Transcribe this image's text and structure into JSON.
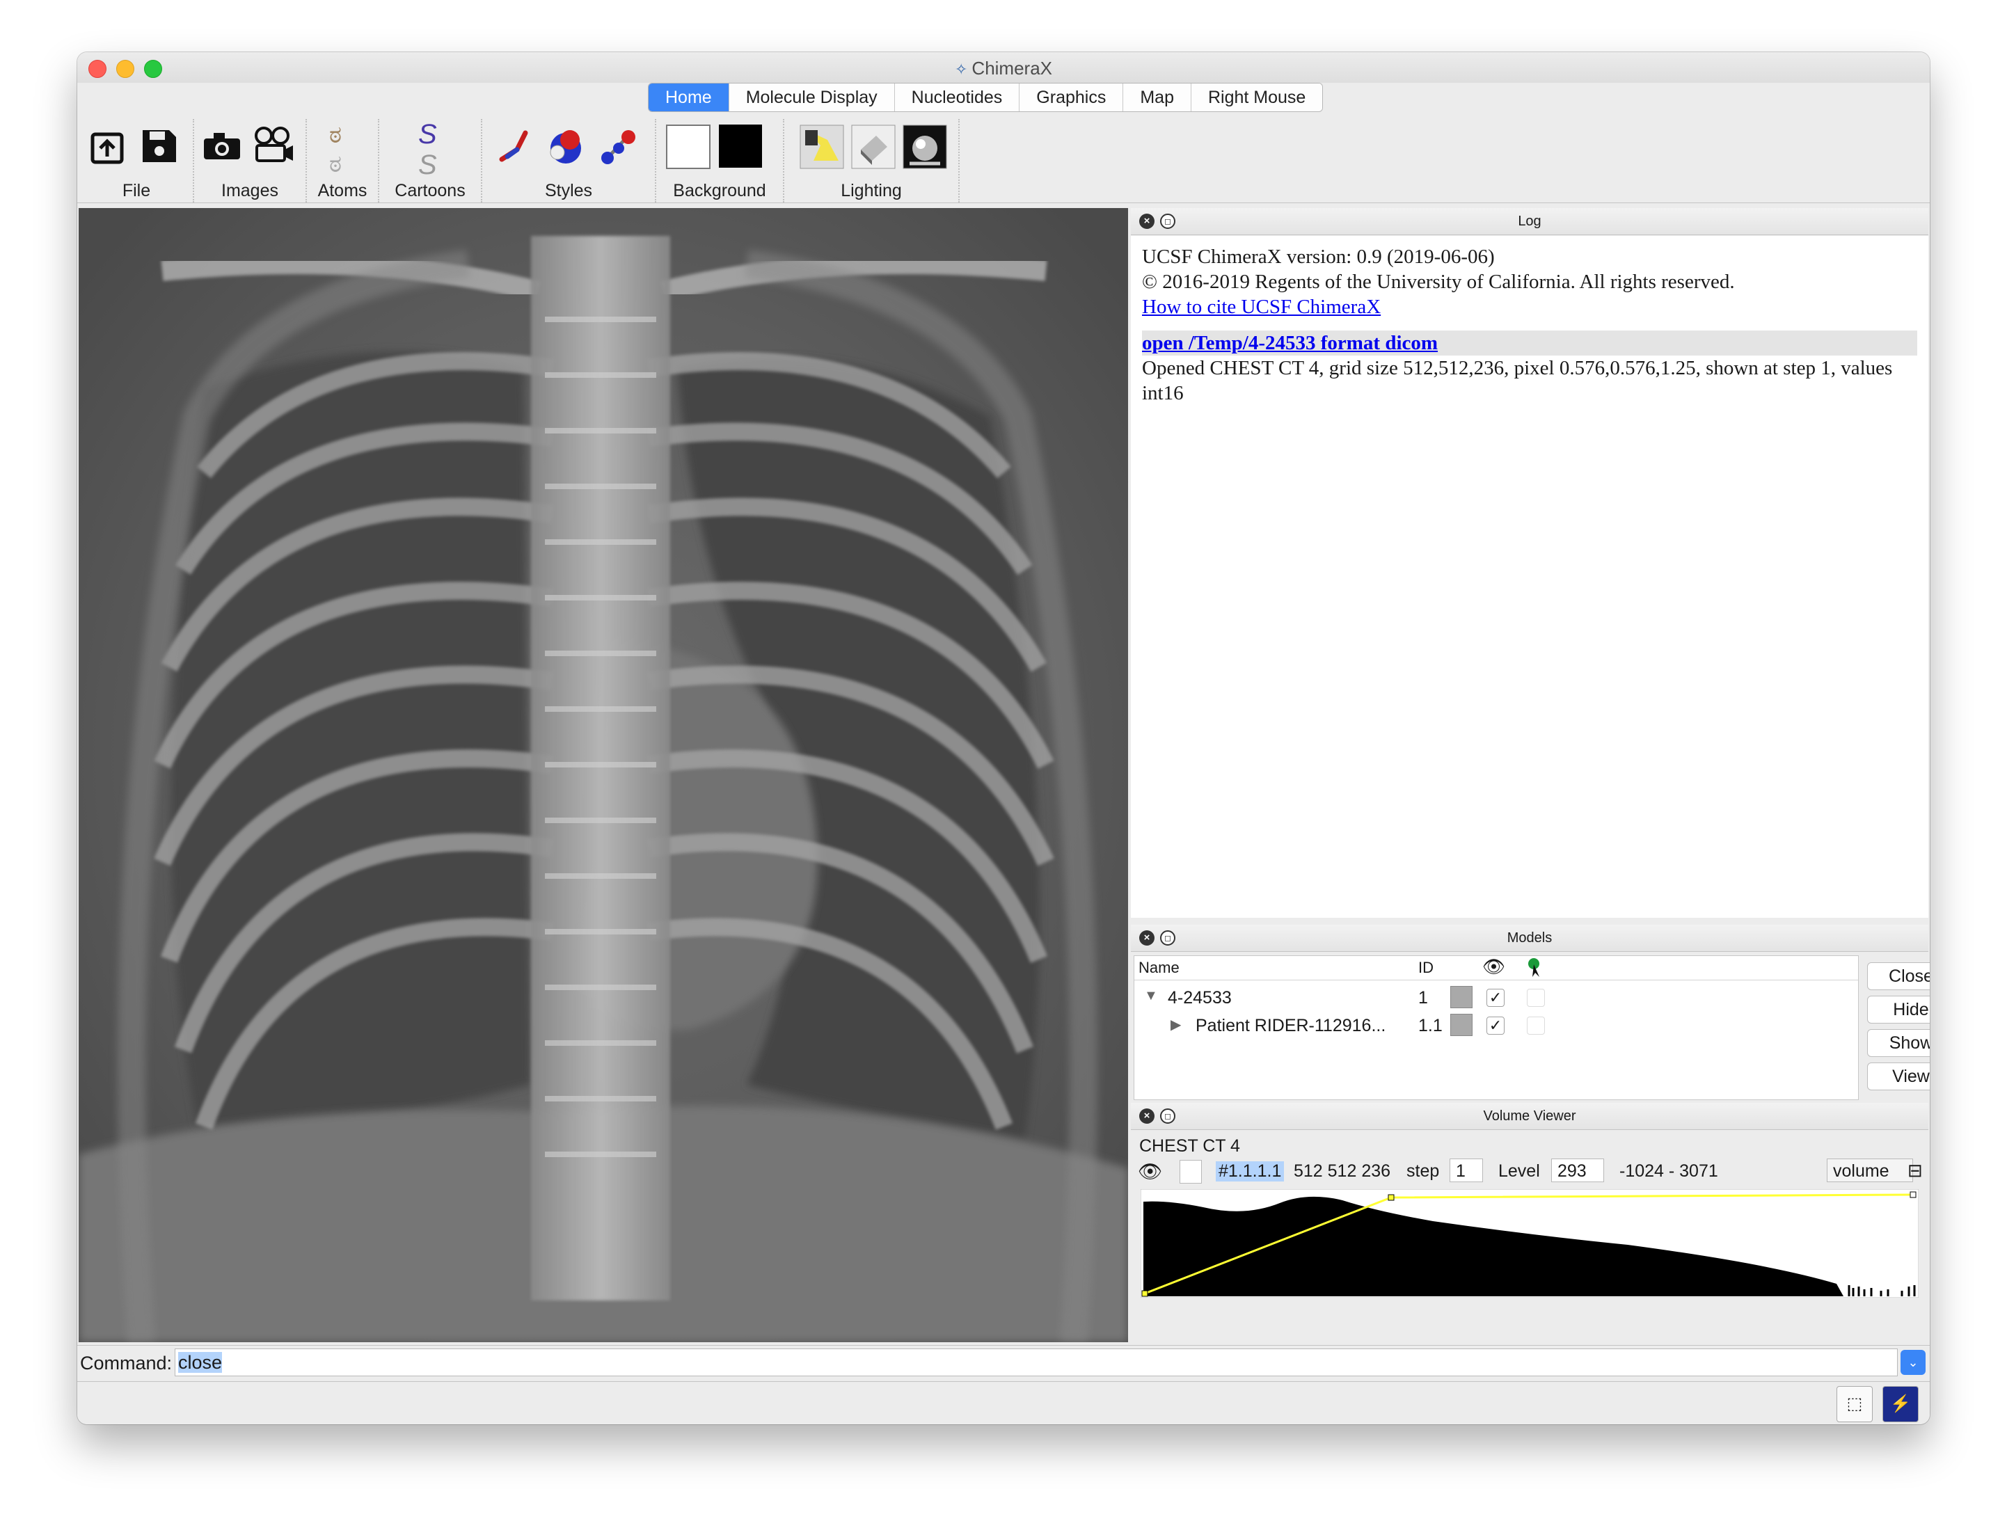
{
  "window": {
    "title": "ChimeraX",
    "app_icon": "chimerax-logo-icon"
  },
  "tabs": [
    {
      "label": "Home",
      "active": true
    },
    {
      "label": "Molecule Display",
      "active": false
    },
    {
      "label": "Nucleotides",
      "active": false
    },
    {
      "label": "Graphics",
      "active": false
    },
    {
      "label": "Map",
      "active": false
    },
    {
      "label": "Right Mouse",
      "active": false
    }
  ],
  "toolbar": {
    "file": "File",
    "images": "Images",
    "atoms": "Atoms",
    "cartoons": "Cartoons",
    "styles": "Styles",
    "background": "Background",
    "lighting": "Lighting"
  },
  "log": {
    "title": "Log",
    "version_line": "UCSF ChimeraX version: 0.9 (2019-06-06)",
    "copyright_line": "© 2016-2019 Regents of the University of California. All rights reserved.",
    "cite_link": "How to cite UCSF ChimeraX",
    "command": "open /Temp/4-24533 format dicom",
    "result": "Opened CHEST CT 4, grid size 512,512,236, pixel 0.576,0.576,1.25, shown at step 1, values int16"
  },
  "models": {
    "title": "Models",
    "columns": {
      "name": "Name",
      "id": "ID"
    },
    "rows": [
      {
        "name": "4-24533",
        "id": "1",
        "shown": true,
        "expanded": true,
        "color": "#a9a9a9"
      },
      {
        "name": "Patient RIDER-112916...",
        "id": "1.1",
        "shown": true,
        "expanded": false,
        "color": "#a9a9a9"
      }
    ],
    "buttons": {
      "close": "Close",
      "hide": "Hide",
      "show": "Show",
      "view": "View"
    }
  },
  "volume_viewer": {
    "title": "Volume Viewer",
    "map_name": "CHEST CT 4",
    "map_id": "#1.1.1.1",
    "grid_size": "512 512 236",
    "step_label": "step",
    "step": "1",
    "level_label": "Level",
    "level": "293",
    "range": "-1024 - 3071",
    "style": "volume"
  },
  "command": {
    "label": "Command:",
    "value": "close"
  },
  "colors": {
    "accent": "#3a86f7",
    "threshold_line": "#ffff33",
    "link": "#0000ee"
  }
}
